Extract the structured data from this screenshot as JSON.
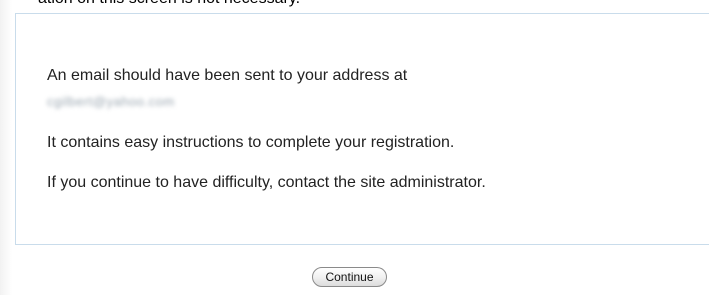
{
  "header": {
    "partial_text": "ation on this screen is not necessary."
  },
  "message": {
    "line1": "An email should have been sent to your address at",
    "email": "cgilbert@yahoo.com",
    "line2": "It contains easy instructions to complete your registration.",
    "line3": "If you continue to have difficulty, contact the site administrator."
  },
  "actions": {
    "continue_label": "Continue"
  },
  "colors": {
    "box_border": "#c9dceb"
  }
}
